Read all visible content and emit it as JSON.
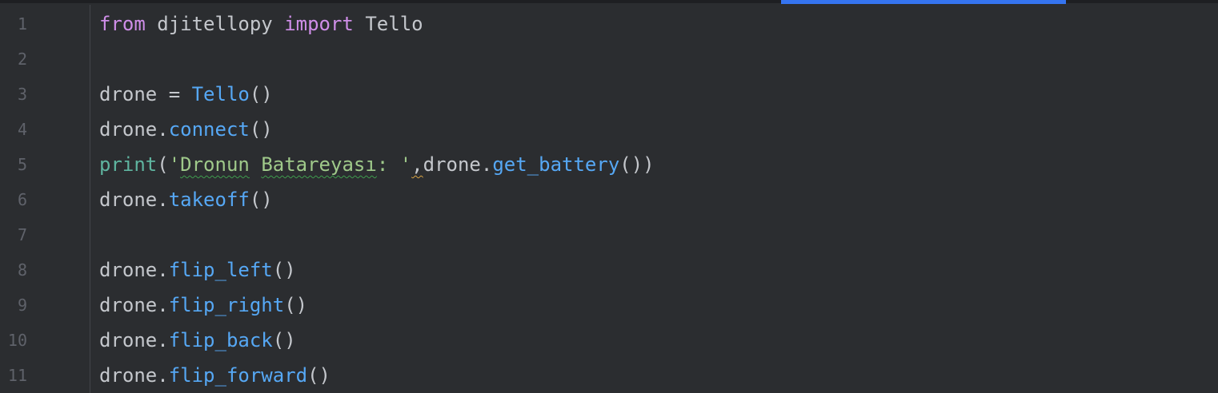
{
  "editor": {
    "line_numbers": [
      "1",
      "2",
      "3",
      "4",
      "5",
      "6",
      "7",
      "8",
      "9",
      "10",
      "11"
    ],
    "lines": {
      "l1": {
        "kw_from": "from",
        "module": " djitellopy ",
        "kw_import": "import",
        "cls": " Tello"
      },
      "l3": {
        "var": "drone = ",
        "ctor": "Tello",
        "parens": "()"
      },
      "l4": {
        "obj": "drone.",
        "method": "connect",
        "parens": "()"
      },
      "l5": {
        "builtin": "print",
        "open": "(",
        "q1": "'",
        "w1": "Dronun",
        "sp1": " ",
        "w2": "Batareyası",
        "tail": ": '",
        "comma": ",",
        "obj": "drone.",
        "method": "get_battery",
        "close": "())"
      },
      "l6": {
        "obj": "drone.",
        "method": "takeoff",
        "parens": "()"
      },
      "l8": {
        "obj": "drone.",
        "method": "flip_left",
        "parens": "()"
      },
      "l9": {
        "obj": "drone.",
        "method": "flip_right",
        "parens": "()"
      },
      "l10": {
        "obj": "drone.",
        "method": "flip_back",
        "parens": "()"
      },
      "l11": {
        "obj": "drone.",
        "method": "flip_forward",
        "parens": "()"
      }
    }
  },
  "colors": {
    "background": "#2b2d30",
    "keyword": "#cf8ee8",
    "function": "#56a8f5",
    "builtin": "#5fb5a0",
    "string": "#9fc98a",
    "default_text": "#c4c7cc",
    "line_number": "#5f626a",
    "scroll_indicator": "#3574f0"
  }
}
